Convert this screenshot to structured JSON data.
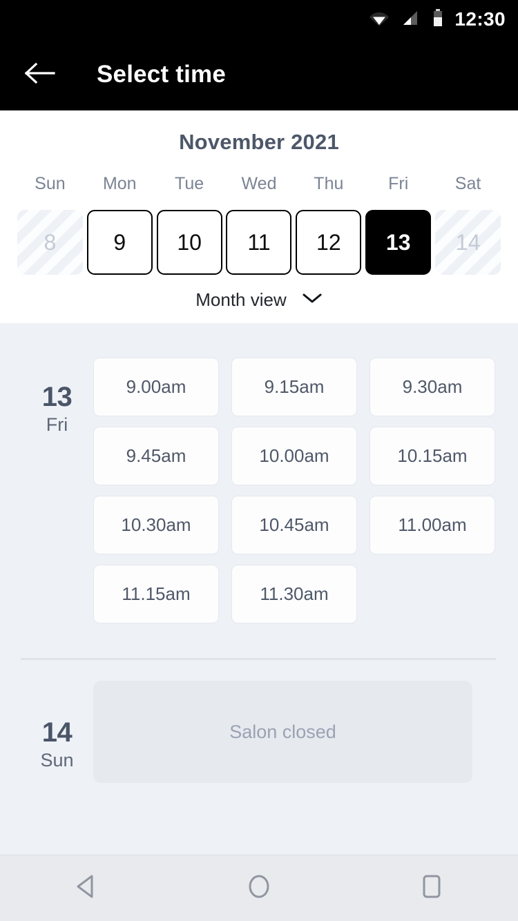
{
  "status_bar": {
    "clock": "12:30",
    "icons": [
      "wifi-icon",
      "cell-signal-icon",
      "battery-icon"
    ]
  },
  "app_bar": {
    "back_icon": "back-arrow-icon",
    "title": "Select time"
  },
  "calendar": {
    "month_title": "November 2021",
    "weekdays": [
      "Sun",
      "Mon",
      "Tue",
      "Wed",
      "Thu",
      "Fri",
      "Sat"
    ],
    "days": [
      {
        "label": "8",
        "state": "disabled"
      },
      {
        "label": "9",
        "state": "available"
      },
      {
        "label": "10",
        "state": "available"
      },
      {
        "label": "11",
        "state": "available"
      },
      {
        "label": "12",
        "state": "available"
      },
      {
        "label": "13",
        "state": "selected"
      },
      {
        "label": "14",
        "state": "disabled"
      }
    ],
    "view_toggle": {
      "label": "Month view",
      "icon": "chevron-down-icon"
    }
  },
  "schedule": [
    {
      "date_num": "13",
      "date_dow": "Fri",
      "slots": [
        "9.00am",
        "9.15am",
        "9.30am",
        "9.45am",
        "10.00am",
        "10.15am",
        "10.30am",
        "10.45am",
        "11.00am",
        "11.15am",
        "11.30am"
      ]
    },
    {
      "date_num": "14",
      "date_dow": "Sun",
      "closed_message": "Salon closed"
    }
  ],
  "nav_bar": {
    "buttons": [
      "back-triangle-icon",
      "home-circle-icon",
      "recents-square-icon"
    ]
  },
  "colors": {
    "app_bar_bg": "#000000",
    "page_bg": "#eef1f6",
    "calendar_bg": "#ffffff",
    "selected_day_bg": "#000000",
    "slot_bg": "#fdfdfe",
    "closed_panel_bg": "#e6e9ee",
    "heading_text": "#4d5769",
    "muted_text": "#9aa3b2"
  }
}
